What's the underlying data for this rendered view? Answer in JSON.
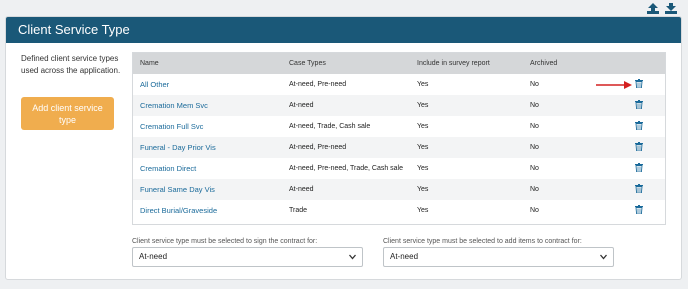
{
  "header": {
    "title": "Client Service Type"
  },
  "sidebar": {
    "description": "Defined client service types used across the application.",
    "add_button": "Add client service type"
  },
  "toolbar": {
    "icons": [
      "upload-icon",
      "download-icon"
    ]
  },
  "table": {
    "columns": [
      "Name",
      "Case Types",
      "Include in survey report",
      "Archived",
      ""
    ],
    "rows": [
      {
        "name": "All Other",
        "case_types": "At-need, Pre-need",
        "survey": "Yes",
        "archived": "No"
      },
      {
        "name": "Cremation Mem Svc",
        "case_types": "At-need",
        "survey": "Yes",
        "archived": "No"
      },
      {
        "name": "Cremation Full Svc",
        "case_types": "At-need, Trade, Cash sale",
        "survey": "Yes",
        "archived": "No"
      },
      {
        "name": "Funeral - Day Prior Vis",
        "case_types": "At-need, Pre-need",
        "survey": "Yes",
        "archived": "No"
      },
      {
        "name": "Cremation Direct",
        "case_types": "At-need, Pre-need, Trade, Cash sale",
        "survey": "Yes",
        "archived": "No"
      },
      {
        "name": "Funeral Same Day Vis",
        "case_types": "At-need",
        "survey": "Yes",
        "archived": "No"
      },
      {
        "name": "Direct Burial/Graveside",
        "case_types": "Trade",
        "survey": "Yes",
        "archived": "No"
      }
    ]
  },
  "selects": {
    "sign_contract": {
      "label": "Client service type must be selected to sign the contract for:",
      "value": "At-need"
    },
    "add_items": {
      "label": "Client service type must be selected to add items to contract for:",
      "value": "At-need"
    }
  },
  "colors": {
    "header": "#1a5878",
    "accent_button": "#f0ad4e",
    "link": "#1a6a9a",
    "arrow": "#d42020"
  }
}
